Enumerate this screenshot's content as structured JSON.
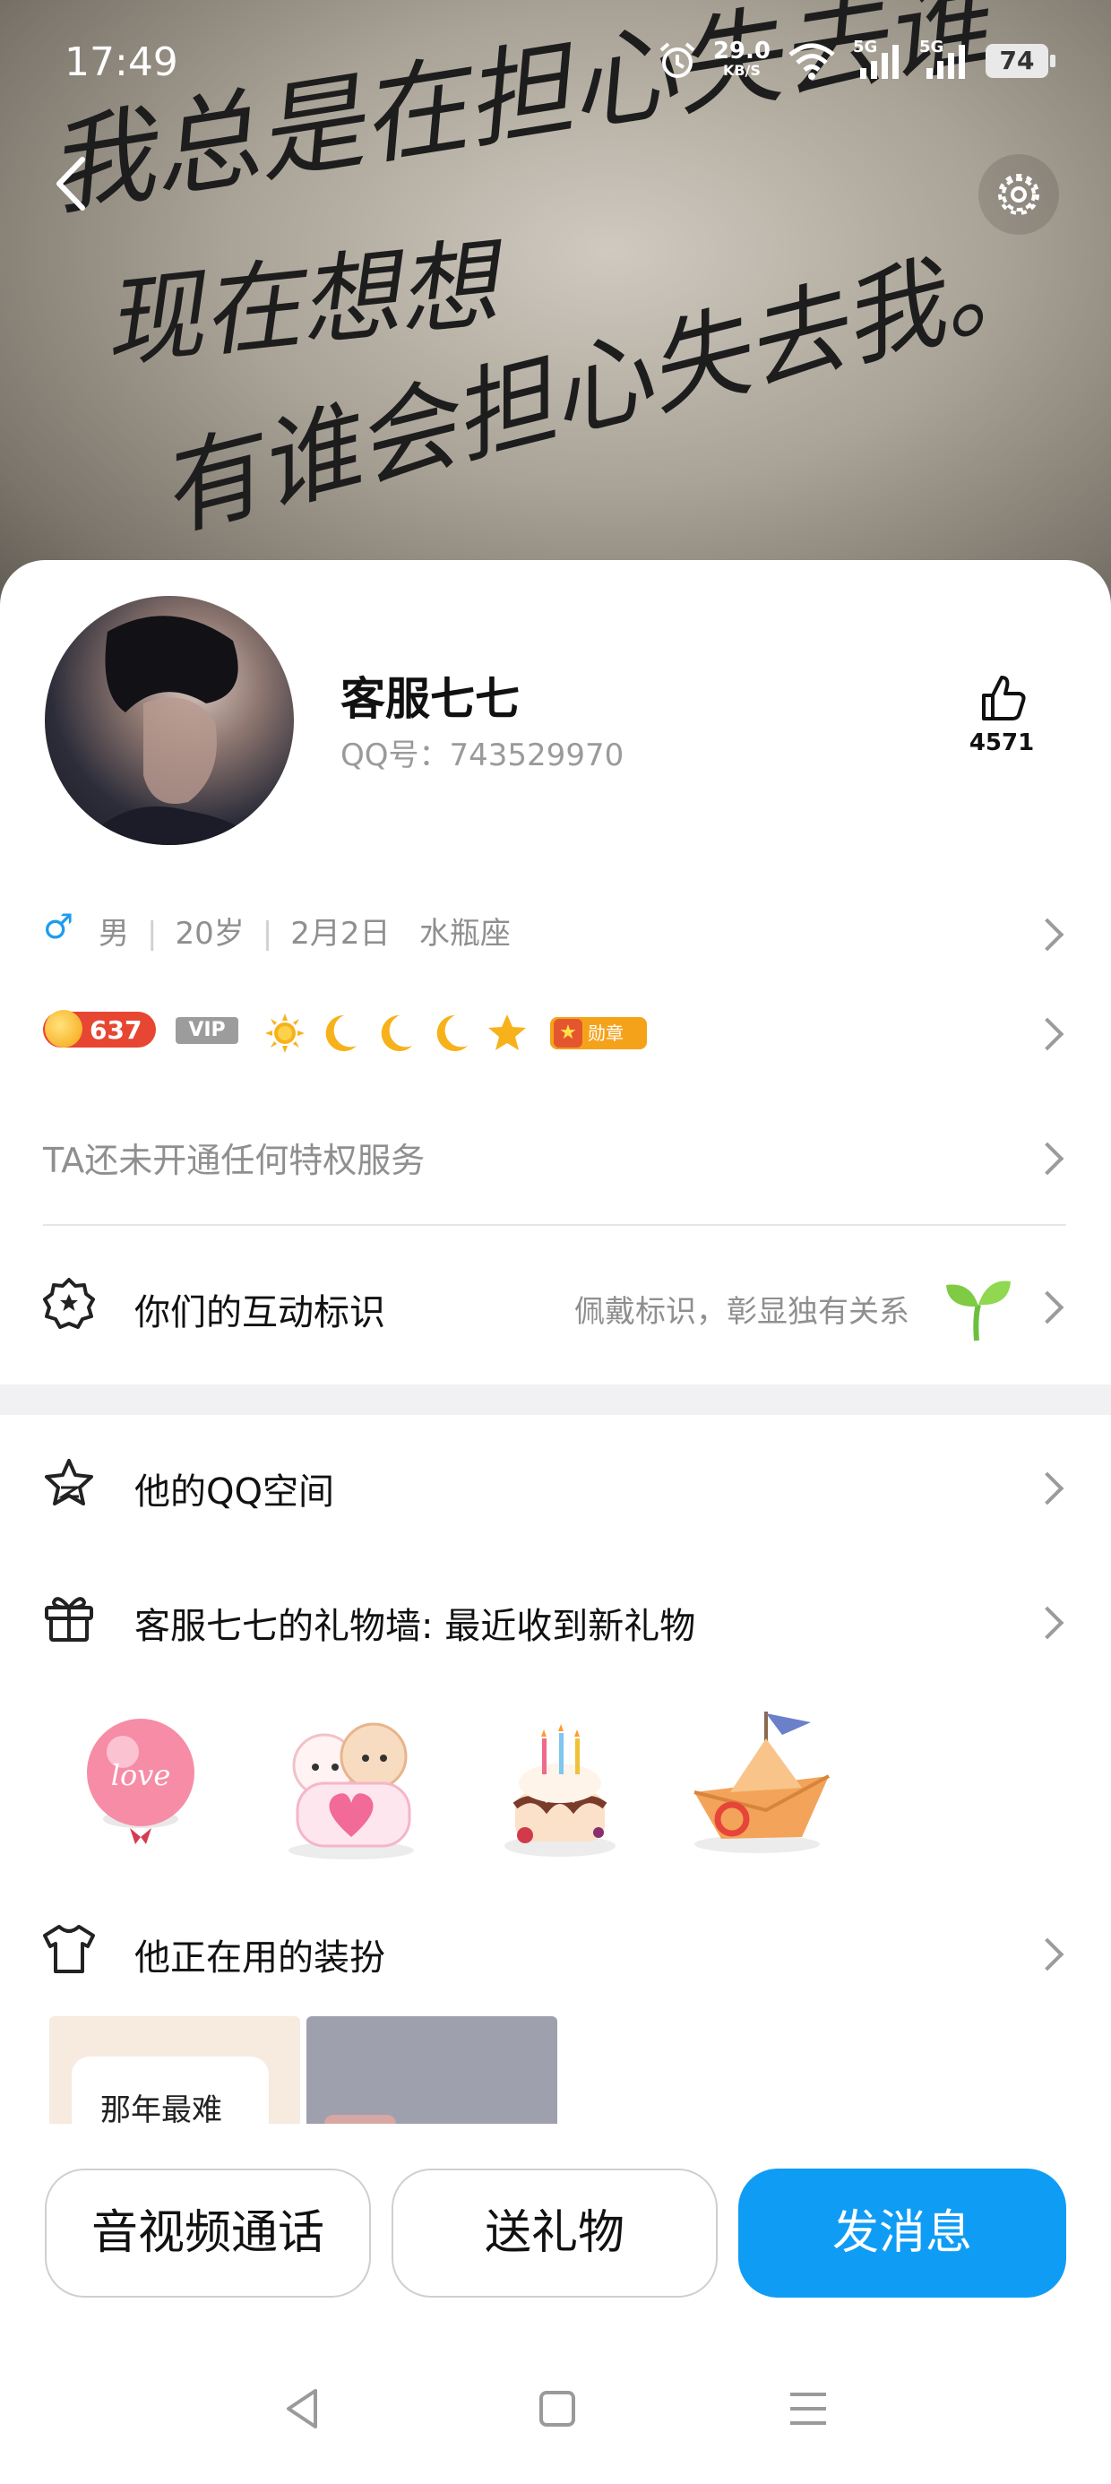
{
  "status_bar": {
    "time": "17:49",
    "net_speed_value": "29.0",
    "net_speed_unit": "KB/S",
    "network_1": "5G",
    "network_2": "5G",
    "battery": "74"
  },
  "header": {
    "background_handwriting": [
      "我总是在担心失去谁",
      "现在想想",
      "有谁会担心失去我。"
    ]
  },
  "profile": {
    "name": "客服七七",
    "qq_label": "QQ号：743529970",
    "likes": "4571"
  },
  "info": {
    "gender": "男",
    "age": "20岁",
    "birthday": "2月2日",
    "zodiac": "水瓶座"
  },
  "levels": {
    "score": "637",
    "vip": "VIP",
    "medal": "勋章"
  },
  "privilege_text": "TA还未开通任何特权服务",
  "interaction": {
    "title": "你们的互动标识",
    "hint": "佩戴标识，彰显独有关系"
  },
  "list": {
    "qzone": "他的QQ空间",
    "gift_wall": "客服七七的礼物墙: 最近收到新礼物",
    "outfit": "他正在用的装扮"
  },
  "gifts": {
    "balloon_text": "love"
  },
  "outfit_preview_text": "那年最难",
  "actions": {
    "call": "音视频通话",
    "gift": "送礼物",
    "message": "发消息"
  },
  "colors": {
    "primary": "#0f9cf5",
    "level_badge": "#e64632",
    "medal": "#f5a21b",
    "male": "#1e9bf0"
  }
}
